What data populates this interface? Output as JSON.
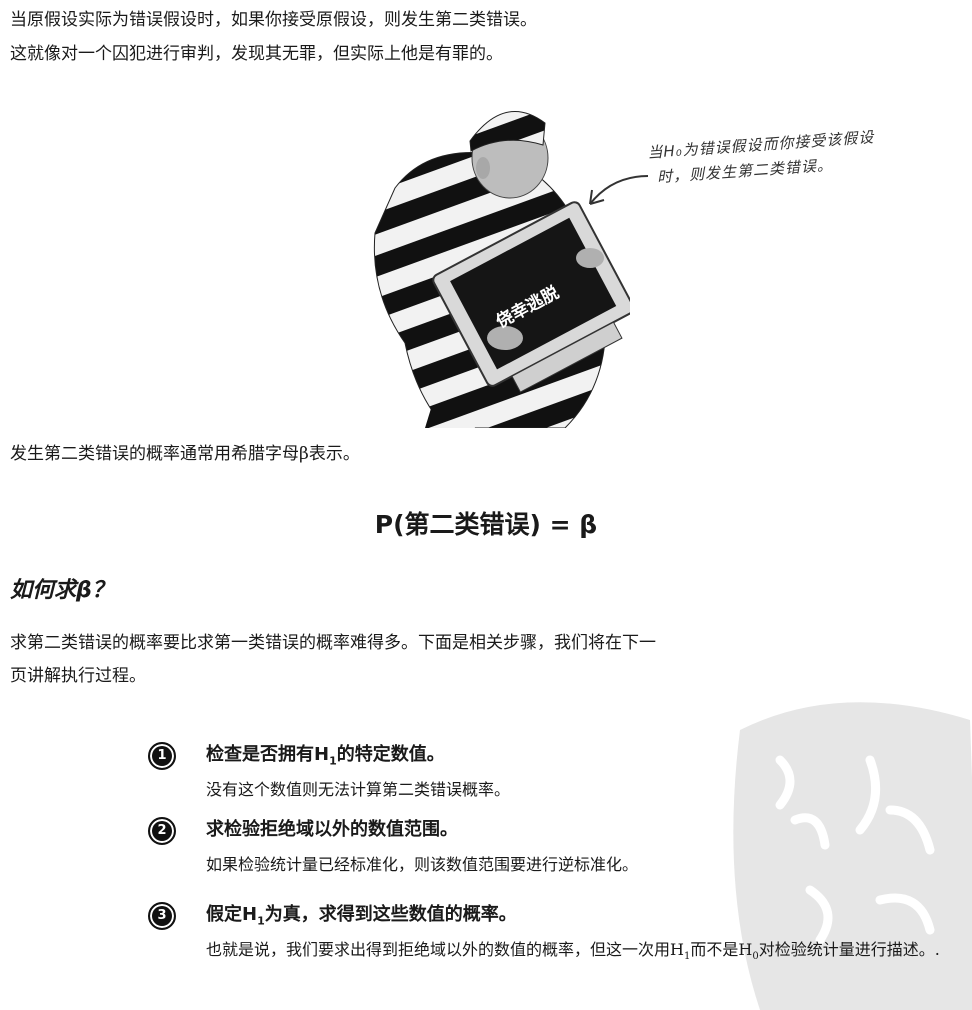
{
  "paragraphs": {
    "p1": "当原假设实际为错误假设时，如果你接受原假设，则发生第二类错误。",
    "p2": "这就像对一个囚犯进行审判，发现其无罪，但实际上他是有罪的。",
    "p3": "发生第二类错误的概率通常用希腊字母β表示。",
    "p4": "求第二类错误的概率要比求第一类错误的概率难得多。下面是相关步骤，我们将在下一页讲解执行过程。"
  },
  "illustration": {
    "monitor_text": "侥幸逃脱",
    "handnote_line1": "当H₀为错误假设而你接受该假设",
    "handnote_line2": "时，则发生第二类错误。"
  },
  "formula": "P(第二类错误) = β",
  "section_heading": "如何求β？",
  "steps": [
    {
      "number": "1",
      "title_pre": "检查是否拥有H",
      "title_sub": "1",
      "title_post": "的特定数值。",
      "desc_pre": "没有这个数值则无法计算第二类错误概率。",
      "desc_sub1": "",
      "desc_mid": "",
      "desc_sub2": "",
      "desc_post": ""
    },
    {
      "number": "2",
      "title_pre": "求检验拒绝域以外的数值范围。",
      "title_sub": "",
      "title_post": "",
      "desc_pre": "如果检验统计量已经标准化，则该数值范围要进行逆标准化。",
      "desc_sub1": "",
      "desc_mid": "",
      "desc_sub2": "",
      "desc_post": ""
    },
    {
      "number": "3",
      "title_pre": "假定H",
      "title_sub": "1",
      "title_post": "为真，求得到这些数值的概率。",
      "desc_pre": "也就是说，我们要求出得到拒绝域以外的数值的概率，但这一次用H",
      "desc_sub1": "1",
      "desc_mid": "而不是H",
      "desc_sub2": "0",
      "desc_post": "对检验统计量进行描述。."
    }
  ],
  "colors": {
    "text": "#1a1a1a",
    "badge": "#111111",
    "stamp": "#e6e6e6"
  }
}
